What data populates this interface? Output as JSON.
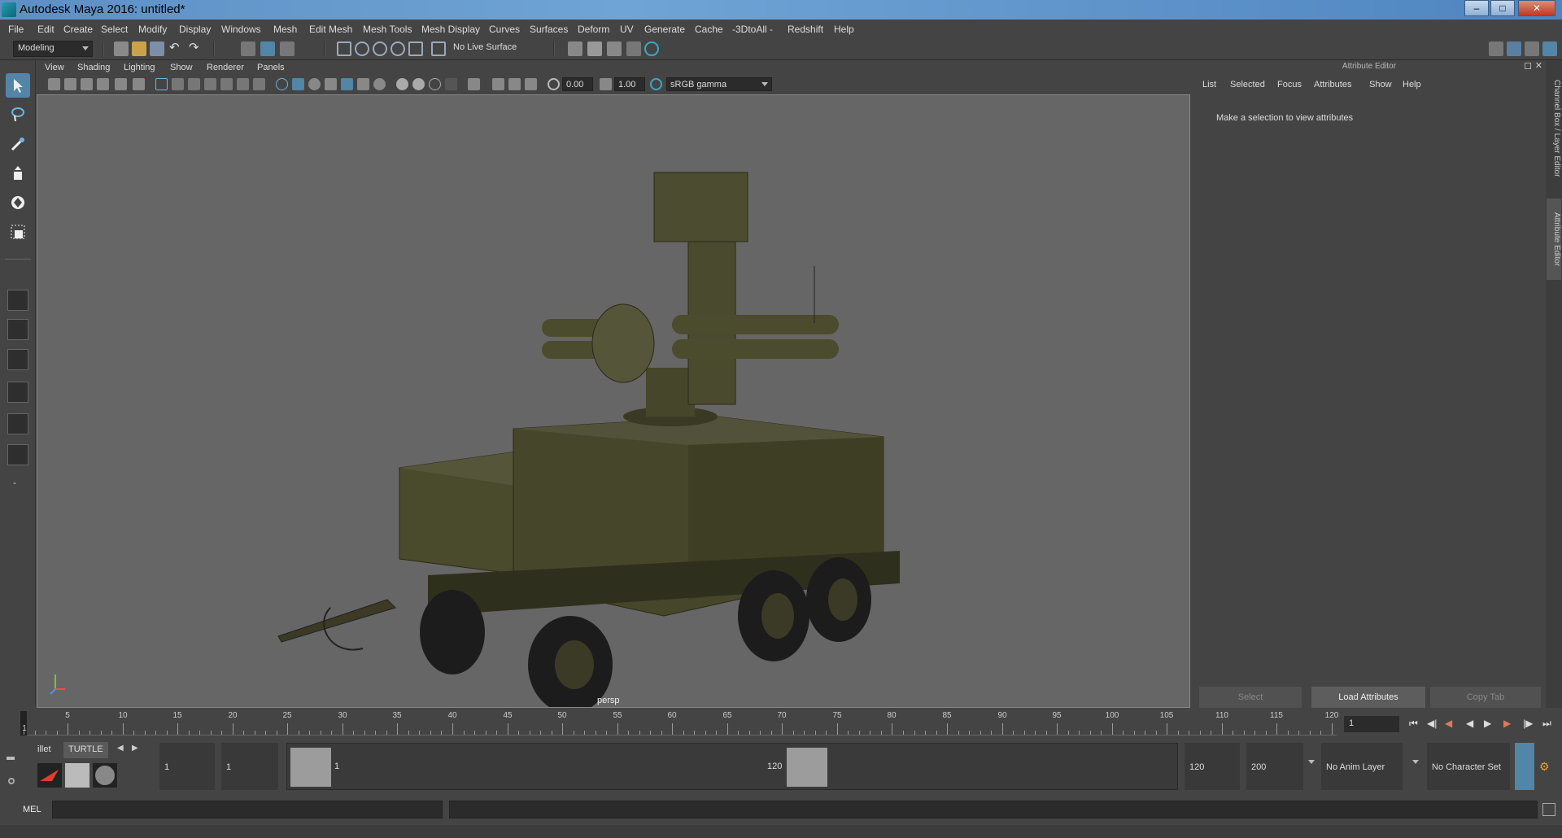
{
  "window": {
    "title": "Autodesk Maya 2016: untitled*"
  },
  "menu": [
    "File",
    "Edit",
    "Create",
    "Select",
    "Modify",
    "Display",
    "Windows",
    "Mesh",
    "Edit Mesh",
    "Mesh Tools",
    "Mesh Display",
    "Curves",
    "Surfaces",
    "Deform",
    "UV",
    "Generate",
    "Cache",
    "-3DtoAll -",
    "Redshift",
    "Help"
  ],
  "status": {
    "mode": "Modeling",
    "live_surface": "No Live Surface"
  },
  "panel": {
    "menu": [
      "View",
      "Shading",
      "Lighting",
      "Show",
      "Renderer",
      "Panels"
    ],
    "exposure": "0.00",
    "gamma": "1.00",
    "color_space": "sRGB gamma",
    "camera": "persp"
  },
  "attribute_editor": {
    "title": "Attribute Editor",
    "menu": [
      "List",
      "Selected",
      "Focus",
      "Attributes",
      "Show",
      "Help"
    ],
    "message": "Make a selection to view attributes",
    "buttons": {
      "select": "Select",
      "load": "Load Attributes",
      "copy": "Copy Tab"
    }
  },
  "side_tabs": {
    "channel": "Channel Box / Layer Editor",
    "attribute": "Attribute Editor"
  },
  "timeline": {
    "ticks": [
      "5",
      "10",
      "15",
      "20",
      "25",
      "30",
      "35",
      "40",
      "45",
      "50",
      "55",
      "60",
      "65",
      "70",
      "75",
      "80",
      "85",
      "90",
      "95",
      "100",
      "105",
      "110",
      "115",
      "120"
    ],
    "current_frame_label": "1",
    "current_frame": "1"
  },
  "range": {
    "start": "1",
    "playback_start": "1",
    "range_start": "1",
    "range_end": "120",
    "playback_end": "120",
    "end": "200",
    "anim_layer": "No Anim Layer",
    "char_set": "No Character Set"
  },
  "shelf": {
    "tab1": "illet",
    "tab2": "TURTLE"
  },
  "cmd": {
    "mel_label": "MEL"
  }
}
